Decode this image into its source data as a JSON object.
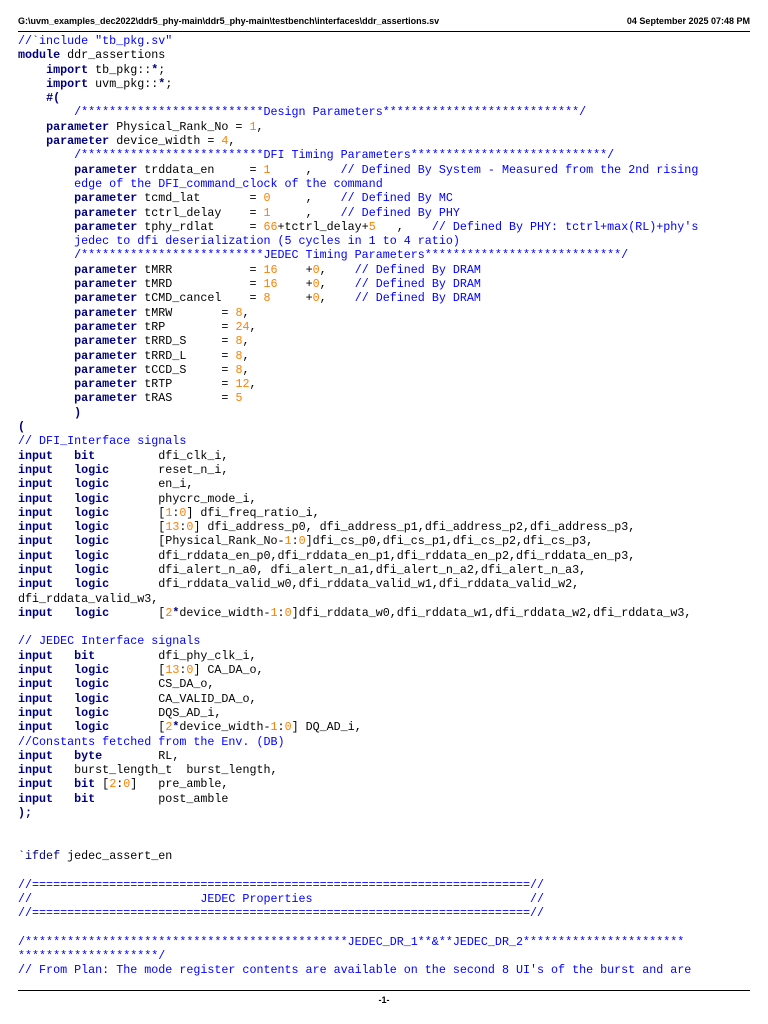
{
  "header": {
    "file_path": "G:\\uvm_examples_dec2022\\ddr5_phy-main\\ddr5_phy-main\\testbench\\interfaces\\ddr_assertions.sv",
    "timestamp": "04 September 2025 07:48 PM"
  },
  "footer": {
    "page_number": "-1-"
  },
  "colors": {
    "keyword": "#00007f",
    "comment": "#0000ff",
    "number": "#ff8000",
    "text": "#000000"
  },
  "code_lines": [
    [
      [
        "cm",
        "//`include \"tb_pkg.sv\""
      ]
    ],
    [
      [
        "kw",
        "module"
      ],
      [
        "t",
        " ddr_assertions"
      ]
    ],
    [
      [
        "t",
        "    "
      ],
      [
        "kw",
        "import"
      ],
      [
        "t",
        " tb_pkg::"
      ],
      [
        "kw",
        "*"
      ],
      [
        "t",
        ";"
      ]
    ],
    [
      [
        "t",
        "    "
      ],
      [
        "kw",
        "import"
      ],
      [
        "t",
        " uvm_pkg::"
      ],
      [
        "kw",
        "*"
      ],
      [
        "t",
        ";"
      ]
    ],
    [
      [
        "t",
        "    "
      ],
      [
        "kw",
        "#("
      ]
    ],
    [
      [
        "t",
        "        "
      ],
      [
        "cm",
        "/**************************Design Parameters****************************/"
      ]
    ],
    [
      [
        "t",
        "    "
      ],
      [
        "kw",
        "parameter"
      ],
      [
        "t",
        " Physical_Rank_No = "
      ],
      [
        "num",
        "1"
      ],
      [
        "t",
        ","
      ]
    ],
    [
      [
        "t",
        "    "
      ],
      [
        "kw",
        "parameter"
      ],
      [
        "t",
        " device_width = "
      ],
      [
        "num",
        "4"
      ],
      [
        "t",
        ","
      ]
    ],
    [
      [
        "t",
        "        "
      ],
      [
        "cm",
        "/**************************DFI Timing Parameters****************************/"
      ]
    ],
    [
      [
        "t",
        "        "
      ],
      [
        "kw",
        "parameter"
      ],
      [
        "t",
        " trddata_en     = "
      ],
      [
        "num",
        "1"
      ],
      [
        "t",
        "     ,    "
      ],
      [
        "cm",
        "// Defined By System - Measured from the 2nd rising"
      ]
    ],
    [
      [
        "t",
        "        "
      ],
      [
        "cm",
        "edge of the DFI_command_clock of the command"
      ]
    ],
    [
      [
        "t",
        "        "
      ],
      [
        "kw",
        "parameter"
      ],
      [
        "t",
        " tcmd_lat       = "
      ],
      [
        "num",
        "0"
      ],
      [
        "t",
        "     ,    "
      ],
      [
        "cm",
        "// Defined By MC"
      ]
    ],
    [
      [
        "t",
        "        "
      ],
      [
        "kw",
        "parameter"
      ],
      [
        "t",
        " tctrl_delay    = "
      ],
      [
        "num",
        "1"
      ],
      [
        "t",
        "     ,    "
      ],
      [
        "cm",
        "// Defined By PHY"
      ]
    ],
    [
      [
        "t",
        "        "
      ],
      [
        "kw",
        "parameter"
      ],
      [
        "t",
        " tphy_rdlat     = "
      ],
      [
        "num",
        "66"
      ],
      [
        "t",
        "+tctrl_delay+"
      ],
      [
        "num",
        "5"
      ],
      [
        "t",
        "   ,    "
      ],
      [
        "cm",
        "// Defined By PHY: tctrl+max(RL)+phy's"
      ]
    ],
    [
      [
        "t",
        "        "
      ],
      [
        "cm",
        "jedec to dfi deserialization (5 cycles in 1 to 4 ratio)"
      ]
    ],
    [
      [
        "t",
        "        "
      ],
      [
        "cm",
        "/**************************JEDEC Timing Parameters****************************/"
      ]
    ],
    [
      [
        "t",
        "        "
      ],
      [
        "kw",
        "parameter"
      ],
      [
        "t",
        " tMRR           = "
      ],
      [
        "num",
        "16"
      ],
      [
        "t",
        "    +"
      ],
      [
        "num",
        "0"
      ],
      [
        "t",
        ",    "
      ],
      [
        "cm",
        "// Defined By DRAM"
      ]
    ],
    [
      [
        "t",
        "        "
      ],
      [
        "kw",
        "parameter"
      ],
      [
        "t",
        " tMRD           = "
      ],
      [
        "num",
        "16"
      ],
      [
        "t",
        "    +"
      ],
      [
        "num",
        "0"
      ],
      [
        "t",
        ",    "
      ],
      [
        "cm",
        "// Defined By DRAM"
      ]
    ],
    [
      [
        "t",
        "        "
      ],
      [
        "kw",
        "parameter"
      ],
      [
        "t",
        " tCMD_cancel    = "
      ],
      [
        "num",
        "8"
      ],
      [
        "t",
        "     +"
      ],
      [
        "num",
        "0"
      ],
      [
        "t",
        ",    "
      ],
      [
        "cm",
        "// Defined By DRAM"
      ]
    ],
    [
      [
        "t",
        "        "
      ],
      [
        "kw",
        "parameter"
      ],
      [
        "t",
        " tMRW       = "
      ],
      [
        "num",
        "8"
      ],
      [
        "t",
        ","
      ]
    ],
    [
      [
        "t",
        "        "
      ],
      [
        "kw",
        "parameter"
      ],
      [
        "t",
        " tRP        = "
      ],
      [
        "num",
        "24"
      ],
      [
        "t",
        ","
      ]
    ],
    [
      [
        "t",
        "        "
      ],
      [
        "kw",
        "parameter"
      ],
      [
        "t",
        " tRRD_S     = "
      ],
      [
        "num",
        "8"
      ],
      [
        "t",
        ","
      ]
    ],
    [
      [
        "t",
        "        "
      ],
      [
        "kw",
        "parameter"
      ],
      [
        "t",
        " tRRD_L     = "
      ],
      [
        "num",
        "8"
      ],
      [
        "t",
        ","
      ]
    ],
    [
      [
        "t",
        "        "
      ],
      [
        "kw",
        "parameter"
      ],
      [
        "t",
        " tCCD_S     = "
      ],
      [
        "num",
        "8"
      ],
      [
        "t",
        ","
      ]
    ],
    [
      [
        "t",
        "        "
      ],
      [
        "kw",
        "parameter"
      ],
      [
        "t",
        " tRTP       = "
      ],
      [
        "num",
        "12"
      ],
      [
        "t",
        ","
      ]
    ],
    [
      [
        "t",
        "        "
      ],
      [
        "kw",
        "parameter"
      ],
      [
        "t",
        " tRAS       = "
      ],
      [
        "num",
        "5"
      ]
    ],
    [
      [
        "t",
        "        "
      ],
      [
        "kw",
        ")"
      ]
    ],
    [
      [
        "kw",
        "("
      ]
    ],
    [
      [
        "cm",
        "// DFI_Interface signals"
      ]
    ],
    [
      [
        "kw",
        "input"
      ],
      [
        "t",
        "   "
      ],
      [
        "kw",
        "bit"
      ],
      [
        "t",
        "         dfi_clk_i,"
      ]
    ],
    [
      [
        "kw",
        "input"
      ],
      [
        "t",
        "   "
      ],
      [
        "kw",
        "logic"
      ],
      [
        "t",
        "       reset_n_i,"
      ]
    ],
    [
      [
        "kw",
        "input"
      ],
      [
        "t",
        "   "
      ],
      [
        "kw",
        "logic"
      ],
      [
        "t",
        "       en_i,"
      ]
    ],
    [
      [
        "kw",
        "input"
      ],
      [
        "t",
        "   "
      ],
      [
        "kw",
        "logic"
      ],
      [
        "t",
        "       phycrc_mode_i,"
      ]
    ],
    [
      [
        "kw",
        "input"
      ],
      [
        "t",
        "   "
      ],
      [
        "kw",
        "logic"
      ],
      [
        "t",
        "       ["
      ],
      [
        "num",
        "1"
      ],
      [
        "t",
        ":"
      ],
      [
        "num",
        "0"
      ],
      [
        "t",
        "] dfi_freq_ratio_i,"
      ]
    ],
    [
      [
        "kw",
        "input"
      ],
      [
        "t",
        "   "
      ],
      [
        "kw",
        "logic"
      ],
      [
        "t",
        "       ["
      ],
      [
        "num",
        "13"
      ],
      [
        "t",
        ":"
      ],
      [
        "num",
        "0"
      ],
      [
        "t",
        "] dfi_address_p0, dfi_address_p1,dfi_address_p2,dfi_address_p3,"
      ]
    ],
    [
      [
        "kw",
        "input"
      ],
      [
        "t",
        "   "
      ],
      [
        "kw",
        "logic"
      ],
      [
        "t",
        "       [Physical_Rank_No-"
      ],
      [
        "num",
        "1"
      ],
      [
        "t",
        ":"
      ],
      [
        "num",
        "0"
      ],
      [
        "t",
        "]dfi_cs_p0,dfi_cs_p1,dfi_cs_p2,dfi_cs_p3,"
      ]
    ],
    [
      [
        "kw",
        "input"
      ],
      [
        "t",
        "   "
      ],
      [
        "kw",
        "logic"
      ],
      [
        "t",
        "       dfi_rddata_en_p0,dfi_rddata_en_p1,dfi_rddata_en_p2,dfi_rddata_en_p3,"
      ]
    ],
    [
      [
        "kw",
        "input"
      ],
      [
        "t",
        "   "
      ],
      [
        "kw",
        "logic"
      ],
      [
        "t",
        "       dfi_alert_n_a0, dfi_alert_n_a1,dfi_alert_n_a2,dfi_alert_n_a3,"
      ]
    ],
    [
      [
        "kw",
        "input"
      ],
      [
        "t",
        "   "
      ],
      [
        "kw",
        "logic"
      ],
      [
        "t",
        "       dfi_rddata_valid_w0,dfi_rddata_valid_w1,dfi_rddata_valid_w2,"
      ]
    ],
    [
      [
        "t",
        "dfi_rddata_valid_w3,"
      ]
    ],
    [
      [
        "kw",
        "input"
      ],
      [
        "t",
        "   "
      ],
      [
        "kw",
        "logic"
      ],
      [
        "t",
        "       ["
      ],
      [
        "num",
        "2"
      ],
      [
        "kw",
        "*"
      ],
      [
        "t",
        "device_width-"
      ],
      [
        "num",
        "1"
      ],
      [
        "t",
        ":"
      ],
      [
        "num",
        "0"
      ],
      [
        "t",
        "]dfi_rddata_w0,dfi_rddata_w1,dfi_rddata_w2,dfi_rddata_w3,"
      ]
    ],
    [],
    [
      [
        "cm",
        "// JEDEC Interface signals"
      ]
    ],
    [
      [
        "kw",
        "input"
      ],
      [
        "t",
        "   "
      ],
      [
        "kw",
        "bit"
      ],
      [
        "t",
        "         dfi_phy_clk_i,"
      ]
    ],
    [
      [
        "kw",
        "input"
      ],
      [
        "t",
        "   "
      ],
      [
        "kw",
        "logic"
      ],
      [
        "t",
        "       ["
      ],
      [
        "num",
        "13"
      ],
      [
        "t",
        ":"
      ],
      [
        "num",
        "0"
      ],
      [
        "t",
        "] CA_DA_o,"
      ]
    ],
    [
      [
        "kw",
        "input"
      ],
      [
        "t",
        "   "
      ],
      [
        "kw",
        "logic"
      ],
      [
        "t",
        "       CS_DA_o,"
      ]
    ],
    [
      [
        "kw",
        "input"
      ],
      [
        "t",
        "   "
      ],
      [
        "kw",
        "logic"
      ],
      [
        "t",
        "       CA_VALID_DA_o,"
      ]
    ],
    [
      [
        "kw",
        "input"
      ],
      [
        "t",
        "   "
      ],
      [
        "kw",
        "logic"
      ],
      [
        "t",
        "       DQS_AD_i,"
      ]
    ],
    [
      [
        "kw",
        "input"
      ],
      [
        "t",
        "   "
      ],
      [
        "kw",
        "logic"
      ],
      [
        "t",
        "       ["
      ],
      [
        "num",
        "2"
      ],
      [
        "kw",
        "*"
      ],
      [
        "t",
        "device_width-"
      ],
      [
        "num",
        "1"
      ],
      [
        "t",
        ":"
      ],
      [
        "num",
        "0"
      ],
      [
        "t",
        "] DQ_AD_i,"
      ]
    ],
    [
      [
        "cm",
        "//Constants fetched from the Env. (DB)"
      ]
    ],
    [
      [
        "kw",
        "input"
      ],
      [
        "t",
        "   "
      ],
      [
        "kw",
        "byte"
      ],
      [
        "t",
        "        RL,"
      ]
    ],
    [
      [
        "kw",
        "input"
      ],
      [
        "t",
        "   burst_length_t  burst_length,"
      ]
    ],
    [
      [
        "kw",
        "input"
      ],
      [
        "t",
        "   "
      ],
      [
        "kw",
        "bit"
      ],
      [
        "t",
        " ["
      ],
      [
        "num",
        "2"
      ],
      [
        "t",
        ":"
      ],
      [
        "num",
        "0"
      ],
      [
        "t",
        "]   pre_amble,"
      ]
    ],
    [
      [
        "kw",
        "input"
      ],
      [
        "t",
        "   "
      ],
      [
        "kw",
        "bit"
      ],
      [
        "t",
        "         post_amble"
      ]
    ],
    [
      [
        "kw",
        ");"
      ]
    ],
    [],
    [],
    [
      [
        "cmd",
        "`ifdef"
      ],
      [
        "t",
        " jedec_assert_en"
      ]
    ],
    [],
    [
      [
        "cm",
        "//=======================================================================//"
      ]
    ],
    [
      [
        "cm",
        "//                        JEDEC Properties                               //"
      ]
    ],
    [
      [
        "cm",
        "//=======================================================================//"
      ]
    ],
    [],
    [
      [
        "cm",
        "/**********************************************JEDEC_DR_1**&**JEDEC_DR_2***********************"
      ]
    ],
    [
      [
        "cm",
        "********************/"
      ]
    ],
    [
      [
        "cm",
        "// From Plan: The mode register contents are available on the second 8 UI's of the burst and are"
      ]
    ]
  ]
}
